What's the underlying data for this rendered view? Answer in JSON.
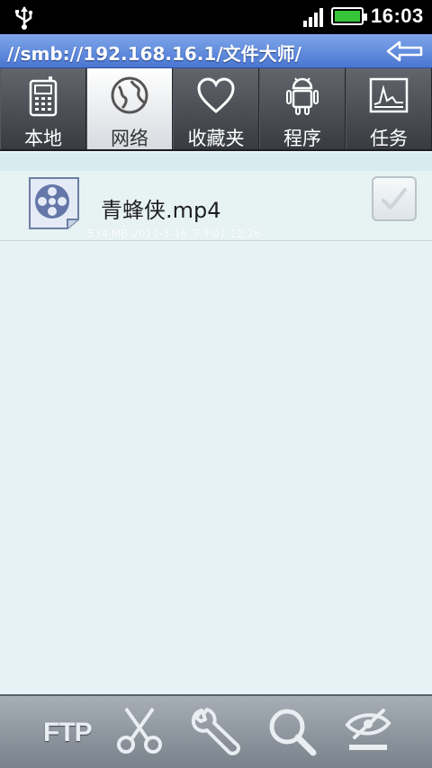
{
  "status_bar": {
    "time": "16:03",
    "usb_icon": "usb-icon",
    "signal_icon": "signal-icon",
    "battery_icon": "battery-icon",
    "battery_color": "#38c438"
  },
  "path_bar": {
    "path": "//smb://192.168.16.1/文件大师/",
    "back_icon": "back-arrow-icon"
  },
  "tabs": [
    {
      "label": "本地",
      "icon": "phone-icon",
      "active": false
    },
    {
      "label": "网络",
      "icon": "globe-icon",
      "active": true
    },
    {
      "label": "收藏夹",
      "icon": "heart-icon",
      "active": false
    },
    {
      "label": "程序",
      "icon": "android-icon",
      "active": false
    },
    {
      "label": "任务",
      "icon": "chart-icon",
      "active": false
    }
  ],
  "files": [
    {
      "name": "青蜂侠.mp4",
      "meta": "534 MB 2011-3-16 下午01:12:26",
      "icon": "video-file-icon",
      "checked": false
    }
  ],
  "toolbar": {
    "ftp_label": "FTP",
    "items": [
      "ftp-button",
      "scissors-icon",
      "wrench-icon",
      "search-icon",
      "hide-icon"
    ]
  },
  "colors": {
    "path_bar": "#5b86dc",
    "active_tab": "#ffffff",
    "list_background": "#e6f2f6"
  }
}
